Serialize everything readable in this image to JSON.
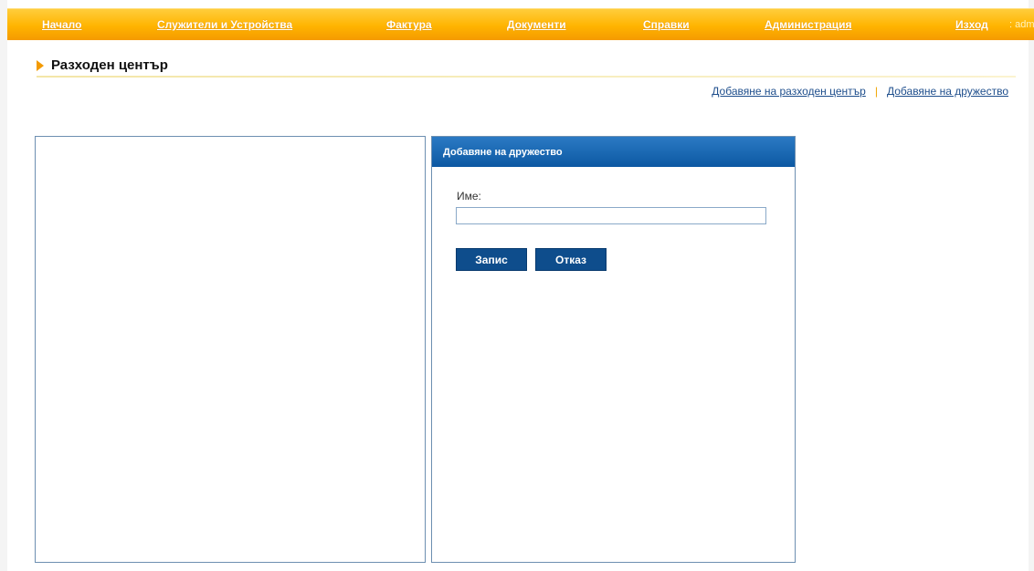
{
  "nav": {
    "items": [
      {
        "label": "Начало"
      },
      {
        "label": "Служители и Устройства"
      },
      {
        "label": "Фактура"
      },
      {
        "label": "Документи"
      },
      {
        "label": "Справки"
      },
      {
        "label": "Администрация"
      },
      {
        "label": "Изход"
      }
    ],
    "user_text": ": adm"
  },
  "page": {
    "title": "Разходен център"
  },
  "actions": {
    "add_cost_center": "Добавяне на разходен център",
    "add_company": "Добавяне на дружество"
  },
  "form": {
    "title": "Добавяне на дружество",
    "name_label": "Име:",
    "name_value": "",
    "save_label": "Запис",
    "cancel_label": "Отказ"
  },
  "colors": {
    "nav_orange": "#ffb400",
    "panel_header_blue": "#0c58a3",
    "button_blue": "#0e4d8c",
    "link_blue": "#1e4e8c"
  }
}
